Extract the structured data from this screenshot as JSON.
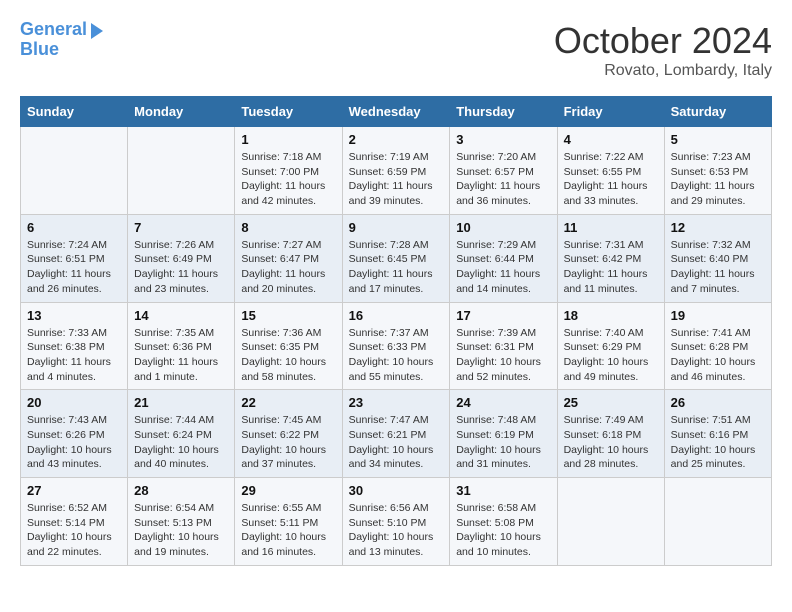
{
  "header": {
    "logo_line1": "General",
    "logo_line2": "Blue",
    "month": "October 2024",
    "location": "Rovato, Lombardy, Italy"
  },
  "days_of_week": [
    "Sunday",
    "Monday",
    "Tuesday",
    "Wednesday",
    "Thursday",
    "Friday",
    "Saturday"
  ],
  "weeks": [
    [
      {
        "day": "",
        "sunrise": "",
        "sunset": "",
        "daylight": ""
      },
      {
        "day": "",
        "sunrise": "",
        "sunset": "",
        "daylight": ""
      },
      {
        "day": "1",
        "sunrise": "Sunrise: 7:18 AM",
        "sunset": "Sunset: 7:00 PM",
        "daylight": "Daylight: 11 hours and 42 minutes."
      },
      {
        "day": "2",
        "sunrise": "Sunrise: 7:19 AM",
        "sunset": "Sunset: 6:59 PM",
        "daylight": "Daylight: 11 hours and 39 minutes."
      },
      {
        "day": "3",
        "sunrise": "Sunrise: 7:20 AM",
        "sunset": "Sunset: 6:57 PM",
        "daylight": "Daylight: 11 hours and 36 minutes."
      },
      {
        "day": "4",
        "sunrise": "Sunrise: 7:22 AM",
        "sunset": "Sunset: 6:55 PM",
        "daylight": "Daylight: 11 hours and 33 minutes."
      },
      {
        "day": "5",
        "sunrise": "Sunrise: 7:23 AM",
        "sunset": "Sunset: 6:53 PM",
        "daylight": "Daylight: 11 hours and 29 minutes."
      }
    ],
    [
      {
        "day": "6",
        "sunrise": "Sunrise: 7:24 AM",
        "sunset": "Sunset: 6:51 PM",
        "daylight": "Daylight: 11 hours and 26 minutes."
      },
      {
        "day": "7",
        "sunrise": "Sunrise: 7:26 AM",
        "sunset": "Sunset: 6:49 PM",
        "daylight": "Daylight: 11 hours and 23 minutes."
      },
      {
        "day": "8",
        "sunrise": "Sunrise: 7:27 AM",
        "sunset": "Sunset: 6:47 PM",
        "daylight": "Daylight: 11 hours and 20 minutes."
      },
      {
        "day": "9",
        "sunrise": "Sunrise: 7:28 AM",
        "sunset": "Sunset: 6:45 PM",
        "daylight": "Daylight: 11 hours and 17 minutes."
      },
      {
        "day": "10",
        "sunrise": "Sunrise: 7:29 AM",
        "sunset": "Sunset: 6:44 PM",
        "daylight": "Daylight: 11 hours and 14 minutes."
      },
      {
        "day": "11",
        "sunrise": "Sunrise: 7:31 AM",
        "sunset": "Sunset: 6:42 PM",
        "daylight": "Daylight: 11 hours and 11 minutes."
      },
      {
        "day": "12",
        "sunrise": "Sunrise: 7:32 AM",
        "sunset": "Sunset: 6:40 PM",
        "daylight": "Daylight: 11 hours and 7 minutes."
      }
    ],
    [
      {
        "day": "13",
        "sunrise": "Sunrise: 7:33 AM",
        "sunset": "Sunset: 6:38 PM",
        "daylight": "Daylight: 11 hours and 4 minutes."
      },
      {
        "day": "14",
        "sunrise": "Sunrise: 7:35 AM",
        "sunset": "Sunset: 6:36 PM",
        "daylight": "Daylight: 11 hours and 1 minute."
      },
      {
        "day": "15",
        "sunrise": "Sunrise: 7:36 AM",
        "sunset": "Sunset: 6:35 PM",
        "daylight": "Daylight: 10 hours and 58 minutes."
      },
      {
        "day": "16",
        "sunrise": "Sunrise: 7:37 AM",
        "sunset": "Sunset: 6:33 PM",
        "daylight": "Daylight: 10 hours and 55 minutes."
      },
      {
        "day": "17",
        "sunrise": "Sunrise: 7:39 AM",
        "sunset": "Sunset: 6:31 PM",
        "daylight": "Daylight: 10 hours and 52 minutes."
      },
      {
        "day": "18",
        "sunrise": "Sunrise: 7:40 AM",
        "sunset": "Sunset: 6:29 PM",
        "daylight": "Daylight: 10 hours and 49 minutes."
      },
      {
        "day": "19",
        "sunrise": "Sunrise: 7:41 AM",
        "sunset": "Sunset: 6:28 PM",
        "daylight": "Daylight: 10 hours and 46 minutes."
      }
    ],
    [
      {
        "day": "20",
        "sunrise": "Sunrise: 7:43 AM",
        "sunset": "Sunset: 6:26 PM",
        "daylight": "Daylight: 10 hours and 43 minutes."
      },
      {
        "day": "21",
        "sunrise": "Sunrise: 7:44 AM",
        "sunset": "Sunset: 6:24 PM",
        "daylight": "Daylight: 10 hours and 40 minutes."
      },
      {
        "day": "22",
        "sunrise": "Sunrise: 7:45 AM",
        "sunset": "Sunset: 6:22 PM",
        "daylight": "Daylight: 10 hours and 37 minutes."
      },
      {
        "day": "23",
        "sunrise": "Sunrise: 7:47 AM",
        "sunset": "Sunset: 6:21 PM",
        "daylight": "Daylight: 10 hours and 34 minutes."
      },
      {
        "day": "24",
        "sunrise": "Sunrise: 7:48 AM",
        "sunset": "Sunset: 6:19 PM",
        "daylight": "Daylight: 10 hours and 31 minutes."
      },
      {
        "day": "25",
        "sunrise": "Sunrise: 7:49 AM",
        "sunset": "Sunset: 6:18 PM",
        "daylight": "Daylight: 10 hours and 28 minutes."
      },
      {
        "day": "26",
        "sunrise": "Sunrise: 7:51 AM",
        "sunset": "Sunset: 6:16 PM",
        "daylight": "Daylight: 10 hours and 25 minutes."
      }
    ],
    [
      {
        "day": "27",
        "sunrise": "Sunrise: 6:52 AM",
        "sunset": "Sunset: 5:14 PM",
        "daylight": "Daylight: 10 hours and 22 minutes."
      },
      {
        "day": "28",
        "sunrise": "Sunrise: 6:54 AM",
        "sunset": "Sunset: 5:13 PM",
        "daylight": "Daylight: 10 hours and 19 minutes."
      },
      {
        "day": "29",
        "sunrise": "Sunrise: 6:55 AM",
        "sunset": "Sunset: 5:11 PM",
        "daylight": "Daylight: 10 hours and 16 minutes."
      },
      {
        "day": "30",
        "sunrise": "Sunrise: 6:56 AM",
        "sunset": "Sunset: 5:10 PM",
        "daylight": "Daylight: 10 hours and 13 minutes."
      },
      {
        "day": "31",
        "sunrise": "Sunrise: 6:58 AM",
        "sunset": "Sunset: 5:08 PM",
        "daylight": "Daylight: 10 hours and 10 minutes."
      },
      {
        "day": "",
        "sunrise": "",
        "sunset": "",
        "daylight": ""
      },
      {
        "day": "",
        "sunrise": "",
        "sunset": "",
        "daylight": ""
      }
    ]
  ]
}
